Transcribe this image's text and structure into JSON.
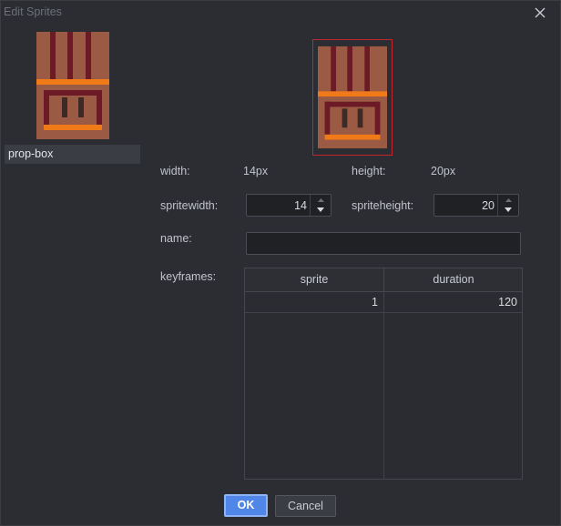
{
  "window": {
    "title": "Edit Sprites"
  },
  "sprite_list": {
    "items": [
      {
        "label": "prop-box"
      }
    ]
  },
  "properties": {
    "width_label": "width:",
    "width_value": "14px",
    "height_label": "height:",
    "height_value": "20px",
    "spritewidth_label": "spritewidth:",
    "spritewidth_value": "14",
    "spriteheight_label": "spriteheight:",
    "spriteheight_value": "20",
    "name_label": "name:",
    "name_value": "",
    "keyframes_label": "keyframes:"
  },
  "keyframes": {
    "columns": [
      "sprite",
      "duration"
    ],
    "rows": [
      {
        "sprite": "1",
        "duration": "120"
      }
    ]
  },
  "buttons": {
    "ok": "OK",
    "cancel": "Cancel"
  },
  "colors": {
    "accent": "#4f86e8",
    "selection_border": "#c0282d",
    "sprite_wood": "#9a5a44",
    "sprite_dark": "#6b1a26",
    "sprite_orange": "#f07a18",
    "sprite_shadow": "#3d2a26"
  },
  "icons": {
    "close": "close-icon",
    "spin_up": "chevron-up-icon",
    "spin_down": "chevron-down-icon"
  }
}
